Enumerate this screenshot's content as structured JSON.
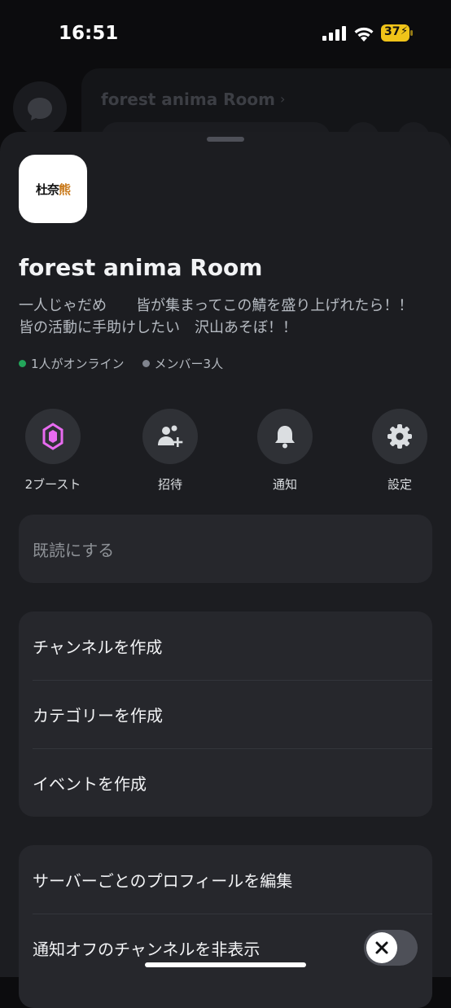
{
  "status_bar": {
    "time": "16:51",
    "battery": "37"
  },
  "background": {
    "server_title": "forest anima Room",
    "chevron": "›"
  },
  "server": {
    "icon_text_a": "杜奈",
    "icon_text_b": "熊",
    "name": "forest anima Room",
    "description": "一人じゃだめ　　皆が集まってこの鯖を盛り上げれたら！！皆の活動に手助けしたい　沢山あそぼ！！",
    "online": "1人がオンライン",
    "members": "メンバー3人"
  },
  "actions": [
    {
      "label": "2ブースト",
      "icon": "boost-icon"
    },
    {
      "label": "招待",
      "icon": "add-user-icon"
    },
    {
      "label": "通知",
      "icon": "bell-icon"
    },
    {
      "label": "設定",
      "icon": "gear-icon"
    }
  ],
  "menu": {
    "mark_read": "既読にする",
    "create_channel": "チャンネルを作成",
    "create_category": "カテゴリーを作成",
    "create_event": "イベントを作成",
    "edit_profile": "サーバーごとのプロフィールを編集",
    "hide_muted": "通知オフのチャンネルを非表示"
  },
  "toggle": {
    "hide_muted_on": false
  },
  "colors": {
    "online": "#23a55a",
    "boost": "#e86bf0",
    "sheet": "#1c1d21",
    "card": "#26272c"
  }
}
